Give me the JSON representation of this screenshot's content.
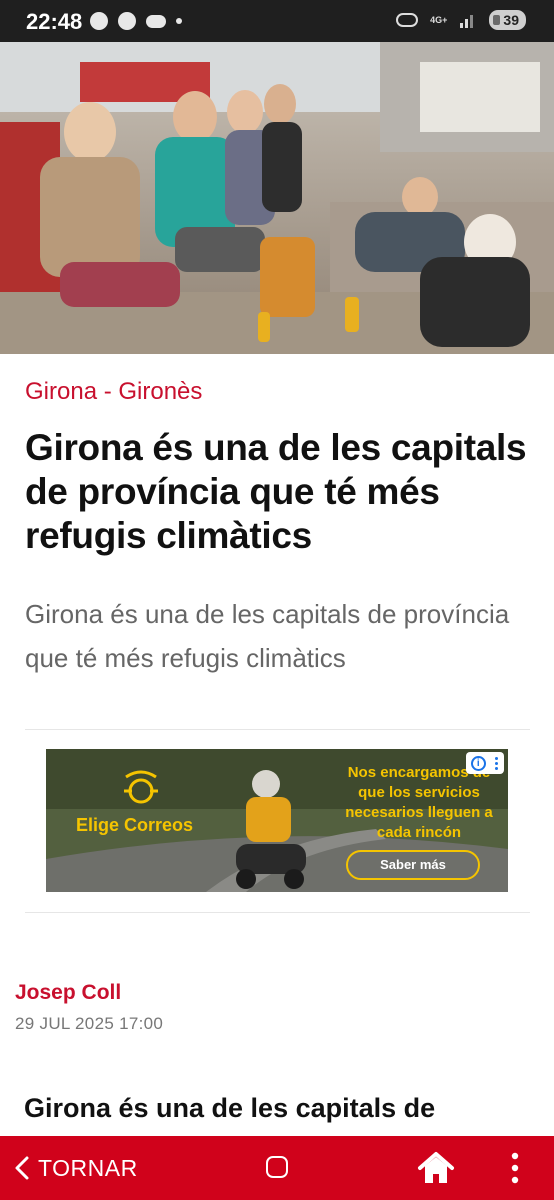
{
  "status_bar": {
    "time": "22:48",
    "network": "4G+",
    "battery": "39"
  },
  "hero_image": {
    "description_icon": "photo-young-people-refuge"
  },
  "article": {
    "category": "Girona - Gironès",
    "headline": "Girona és una de les capitals de província que té més refugis climàtics",
    "subtitle": "Girona és una de les capitals de província que té més refugis climàtics",
    "author": "Josep Coll",
    "date": "29 JUL 2025 17:00",
    "body_headline": "Girona és una de les capitals de"
  },
  "ad": {
    "brand": "Elige Correos",
    "text": "Nos encargamos de que los servicios necesarios lleguen a cada rincón",
    "cta": "Saber más",
    "brand_color": "#f5c400"
  },
  "bottom_bar": {
    "back_label": "TORNAR",
    "color": "#d0021b"
  }
}
